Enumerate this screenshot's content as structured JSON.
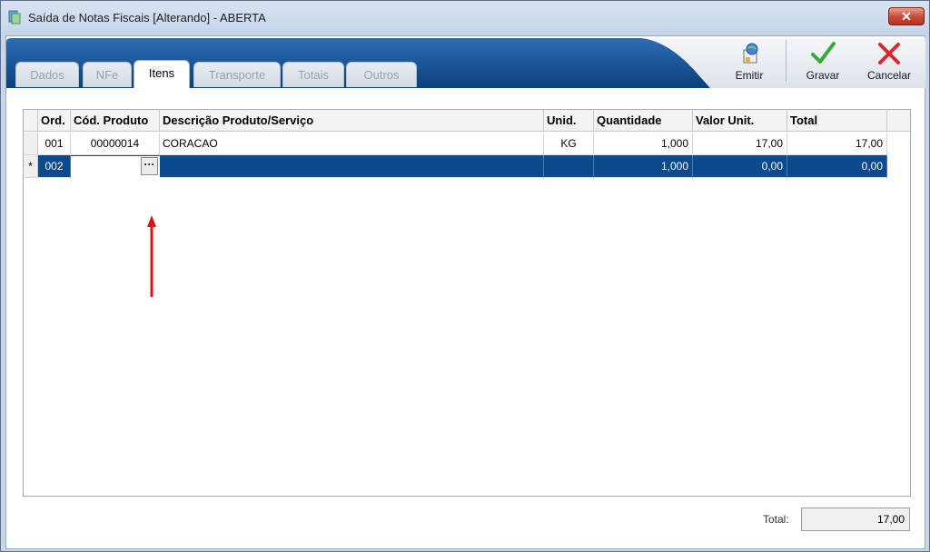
{
  "window": {
    "title": "Saída de Notas Fiscais [Alterando]  - ABERTA",
    "close_label": "✕"
  },
  "tabs": [
    {
      "label": "Dados",
      "active": false
    },
    {
      "label": "NFe",
      "active": false
    },
    {
      "label": "Itens",
      "active": true
    },
    {
      "label": "Transporte",
      "active": false
    },
    {
      "label": "Totais",
      "active": false
    },
    {
      "label": "Outros",
      "active": false
    }
  ],
  "toolbar": {
    "emitir": "Emitir",
    "gravar": "Gravar",
    "cancelar": "Cancelar"
  },
  "grid": {
    "columns": [
      "Ord.",
      "Cód. Produto",
      "Descrição Produto/Serviço",
      "Unid.",
      "Quantidade",
      "Valor Unit.",
      "Total"
    ],
    "rows": [
      {
        "indicator": "",
        "ord": "001",
        "cod": "00000014",
        "desc": "CORACAO",
        "unid": "KG",
        "qtd": "1,000",
        "valor": "17,00",
        "total": "17,00"
      },
      {
        "indicator": "*",
        "ord": "002",
        "cod": "",
        "desc": "",
        "unid": "",
        "qtd": "1,000",
        "valor": "0,00",
        "total": "0,00"
      }
    ],
    "ellipsis": "···"
  },
  "footer": {
    "total_label": "Total:",
    "total_value": "17,00"
  },
  "colors": {
    "header_blue": "#0c4a8e",
    "selection": "#0c4a8e",
    "arrow": "#e01010"
  },
  "icons": [
    "window-app-icon",
    "emitir-icon",
    "check-icon",
    "cancel-x-icon",
    "red-arrow-icon"
  ]
}
